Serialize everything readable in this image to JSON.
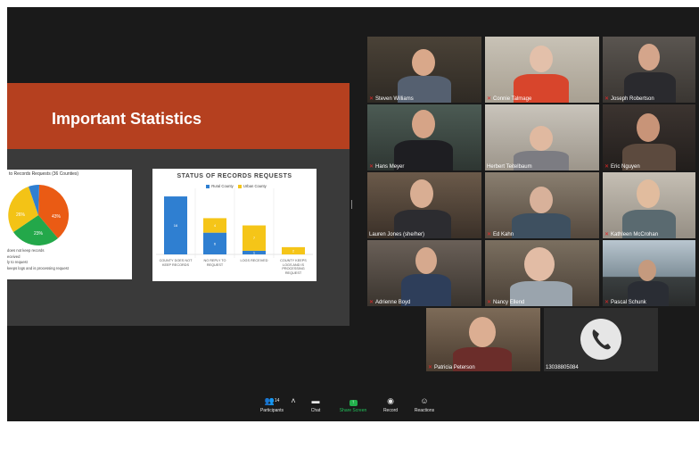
{
  "slide": {
    "title": "Important Statistics",
    "pie_card": {
      "title": "to Records Requests (36 Counties)",
      "slice_labels": [
        "43%",
        "23%",
        "26%"
      ],
      "legend": [
        "does not keep records",
        "eceived",
        "ly to request",
        "keeps logs and is processing request"
      ]
    },
    "bar_card": {
      "title": "STATUS OF RECORDS REQUESTS",
      "legend_rural": "Rural County",
      "legend_urban": "Urban County",
      "colors": {
        "rural": "#2f7fd1",
        "urban": "#f5c518"
      }
    }
  },
  "chart_data": {
    "type": "bar",
    "title": "STATUS OF RECORDS REQUESTS",
    "categories": [
      "COUNTY DOES NOT KEEP RECORDS",
      "NO REPLY TO REQUEST",
      "LOGS RECEIVED",
      "COUNTY KEEPS LOGS AND IS PROCESSING REQUEST"
    ],
    "series": [
      {
        "name": "Rural County",
        "values": [
          16,
          6,
          1,
          0
        ]
      },
      {
        "name": "Urban County",
        "values": [
          0,
          4,
          7,
          2
        ]
      }
    ],
    "bar_labels": [
      [
        "16",
        "6",
        "1",
        ""
      ],
      [
        "",
        "4",
        "7",
        "2"
      ]
    ],
    "ylim": [
      0,
      17
    ],
    "stacked": true
  },
  "participants": [
    {
      "name": "Steven Williams",
      "muted": true
    },
    {
      "name": "Connie Talmage",
      "muted": true
    },
    {
      "name": "Joseph Robertson",
      "muted": true
    },
    {
      "name": "Hans Meyer",
      "muted": true
    },
    {
      "name": "Herbert Teitelbaum",
      "muted": false
    },
    {
      "name": "Eric Nguyen",
      "muted": true
    },
    {
      "name": "Lauren Jones (she/her)",
      "muted": false,
      "active": true
    },
    {
      "name": "Ed Kahn",
      "muted": true
    },
    {
      "name": "Kathleen McCrohan",
      "muted": true
    },
    {
      "name": "Adrienne Boyd",
      "muted": true
    },
    {
      "name": "Nancy Ellend",
      "muted": true
    },
    {
      "name": "Pascal Schunk",
      "muted": true
    },
    {
      "name": "Patricia Peterson",
      "muted": true
    }
  ],
  "phone_participant": "13038805084",
  "toolbar": {
    "participants_label": "Participants",
    "participants_count": "14",
    "chat_label": "Chat",
    "share_label": "Share Screen",
    "record_label": "Record",
    "reactions_label": "Reactions"
  }
}
